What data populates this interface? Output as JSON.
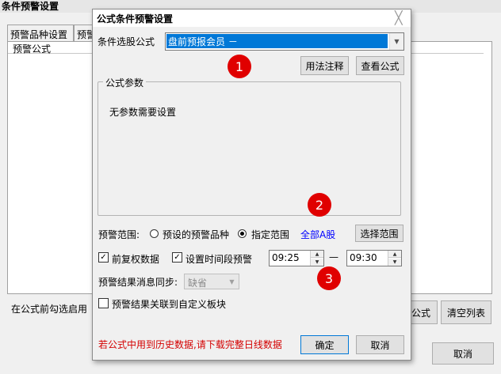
{
  "outer": {
    "title": "条件预警设置",
    "tabs": [
      "预警品种设置",
      "预警"
    ],
    "list_header": "预警公式",
    "hint": "在公式前勾选启用",
    "buttons": {
      "formula": "公式",
      "clear_list": "清空列表",
      "cancel": "取消"
    }
  },
  "dialog": {
    "title": "公式条件预警设置",
    "close_glyph": "╳",
    "formula_label": "条件选股公式",
    "formula_value": "盘前预报会员  －",
    "buttons": {
      "usage_notes": "用法注释",
      "view_formula": "查看公式",
      "select_range": "选择范围",
      "ok": "确定",
      "cancel": "取消"
    },
    "params_group_title": "公式参数",
    "params_text": "无参数需要设置",
    "range": {
      "label": "预警范围:",
      "option_preset": "预设的预警品种",
      "option_specified": "指定范围",
      "selected": "指定范围",
      "summary": "全部A股"
    },
    "pre_adjust": {
      "label": "前复权数据",
      "checked": true
    },
    "time_window": {
      "label": "设置时间段预警",
      "checked": true,
      "start": "09:25",
      "dash": "—",
      "end": "09:30"
    },
    "sync": {
      "label": "预警结果消息同步:",
      "value": "缺省"
    },
    "link_board": {
      "label": "预警结果关联到自定义板块",
      "checked": false
    },
    "warning": "若公式中用到历史数据,请下载完整日线数据"
  },
  "annotations": [
    "1",
    "2",
    "3"
  ],
  "colors": {
    "selection": "#0078d7",
    "badge": "#e00000",
    "warning_text": "#d40000",
    "link": "#0000ff"
  }
}
